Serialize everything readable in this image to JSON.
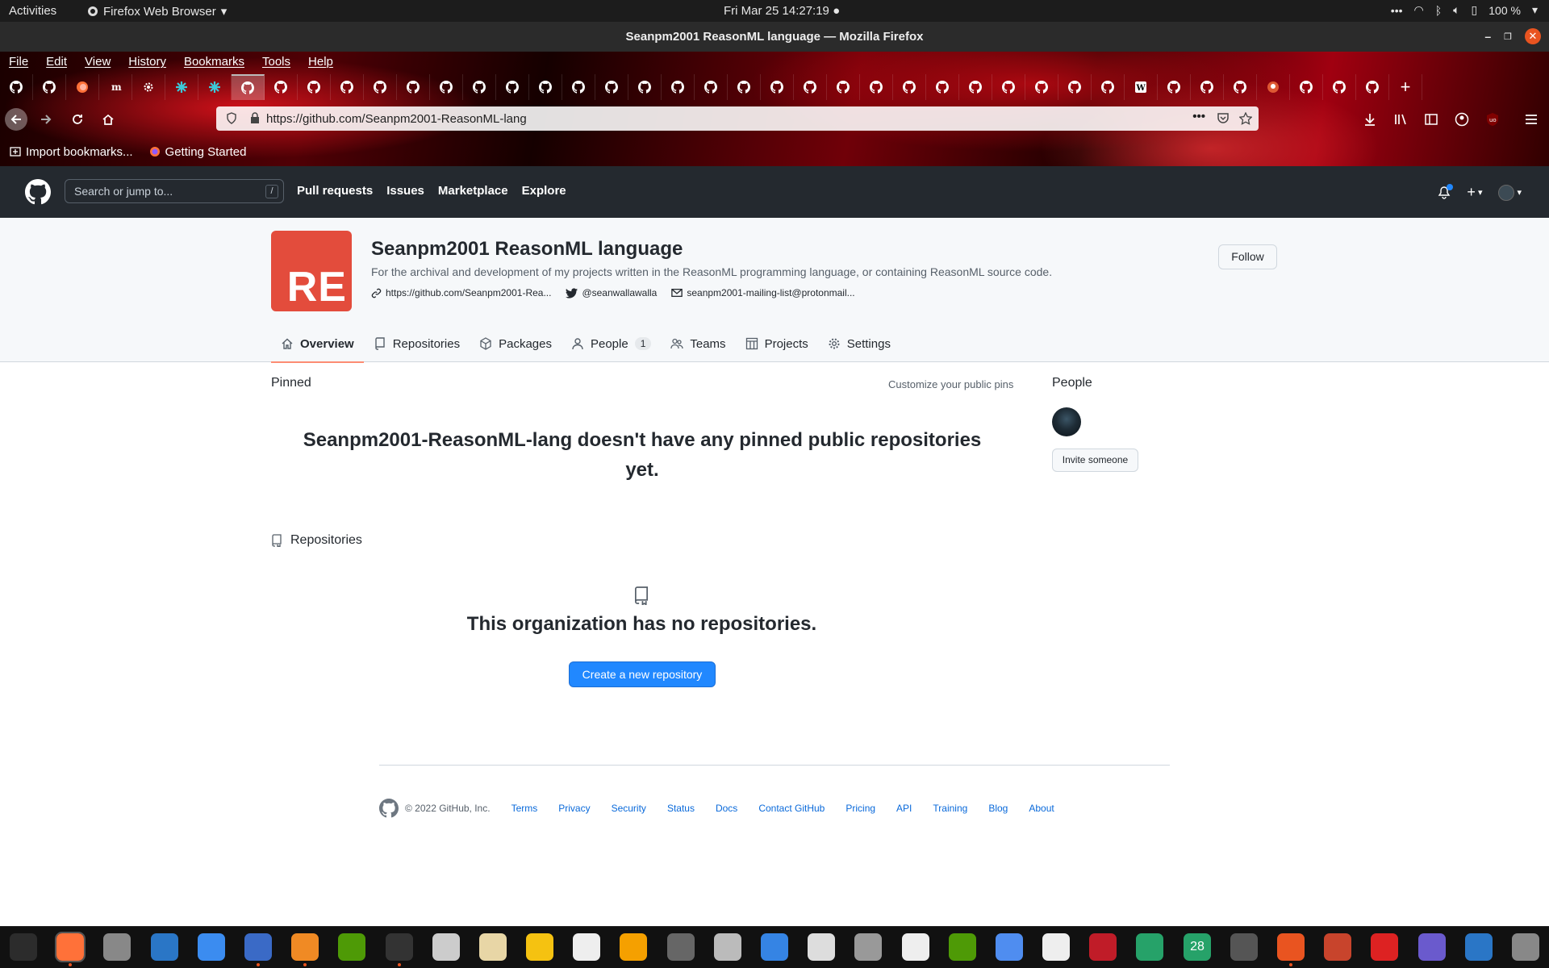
{
  "topbar": {
    "activities": "Activities",
    "app_name": "Firefox Web Browser",
    "clock": "Fri Mar 25  14:27:19",
    "battery": "100 %"
  },
  "window": {
    "title": "Seanpm2001 ReasonML language — Mozilla Firefox"
  },
  "menu": [
    "File",
    "Edit",
    "View",
    "History",
    "Bookmarks",
    "Tools",
    "Help"
  ],
  "tabs": {
    "icons": [
      "github-icon",
      "github-icon",
      "firefox-icon",
      "m-icon",
      "gear-icon",
      "puzzle-icon",
      "puzzle-icon",
      "github-icon",
      "github-icon",
      "github-icon",
      "github-icon",
      "github-icon",
      "github-icon",
      "github-icon",
      "github-icon",
      "github-icon",
      "github-icon",
      "github-icon",
      "github-icon",
      "github-icon",
      "github-icon",
      "github-icon",
      "github-icon",
      "github-icon",
      "github-icon",
      "github-icon",
      "github-icon",
      "github-icon",
      "github-icon",
      "github-icon",
      "github-icon",
      "github-icon",
      "github-icon",
      "github-icon",
      "wikipedia-icon",
      "github-icon",
      "github-icon",
      "github-icon",
      "duckduckgo-icon",
      "github-icon",
      "github-icon",
      "github-icon"
    ],
    "active_index": 7
  },
  "urlbar": {
    "url": "https://github.com/Seanpm2001-ReasonML-lang"
  },
  "bookmarks": [
    "Import bookmarks...",
    "Getting Started"
  ],
  "gh": {
    "search_placeholder": "Search or jump to...",
    "search_key": "/",
    "nav": [
      "Pull requests",
      "Issues",
      "Marketplace",
      "Explore"
    ]
  },
  "org": {
    "avatar_text": "RE",
    "name": "Seanpm2001 ReasonML language",
    "description": "For the archival and development of my projects written in the ReasonML programming language, or containing ReasonML source code.",
    "website": "https://github.com/Seanpm2001-Rea...",
    "twitter": "@seanwallawalla",
    "email": "seanpm2001-mailing-list@protonmail...",
    "follow": "Follow",
    "tabs": [
      {
        "label": "Overview",
        "icon": "home-icon"
      },
      {
        "label": "Repositories",
        "icon": "repo-icon"
      },
      {
        "label": "Packages",
        "icon": "package-icon"
      },
      {
        "label": "People",
        "icon": "person-icon",
        "count": "1"
      },
      {
        "label": "Teams",
        "icon": "people-icon"
      },
      {
        "label": "Projects",
        "icon": "project-icon"
      },
      {
        "label": "Settings",
        "icon": "gear-icon"
      }
    ]
  },
  "main": {
    "pinned_label": "Pinned",
    "customize": "Customize your public pins",
    "pinned_empty": "Seanpm2001-ReasonML-lang doesn't have any pinned public repositories yet.",
    "repos_label": "Repositories",
    "repos_empty": "This organization has no repositories.",
    "create_button": "Create a new repository"
  },
  "sidebar": {
    "people_label": "People",
    "invite_button": "Invite someone"
  },
  "footer": {
    "copyright": "© 2022 GitHub, Inc.",
    "links": [
      "Terms",
      "Privacy",
      "Security",
      "Status",
      "Docs",
      "Contact GitHub",
      "Pricing",
      "API",
      "Training",
      "Blog",
      "About"
    ]
  },
  "dock": {
    "apps": [
      "system-monitor-icon",
      "firefox-icon",
      "settings-icon",
      "text-document-icon",
      "help-icon",
      "text-editor-icon",
      "vlc-icon",
      "puzzle-icon",
      "terminal-icon",
      "image-viewer-icon",
      "files-icon",
      "calculator-icon",
      "graph-icon",
      "app-store-icon",
      "disks-icon",
      "inkscape-icon",
      "todo-icon",
      "presentation-icon",
      "archive-icon",
      "character-map-icon",
      "vim-icon",
      "screen-icon",
      "music-icon",
      "pdf-icon",
      "spreadsheet-icon",
      "calendar-icon",
      "gimp-icon",
      "update-icon",
      "mario-icon",
      "alert-icon",
      "camera-icon",
      "store-icon",
      "ubuntu-software-icon"
    ],
    "calendar_day": "28",
    "active_index": 1
  }
}
